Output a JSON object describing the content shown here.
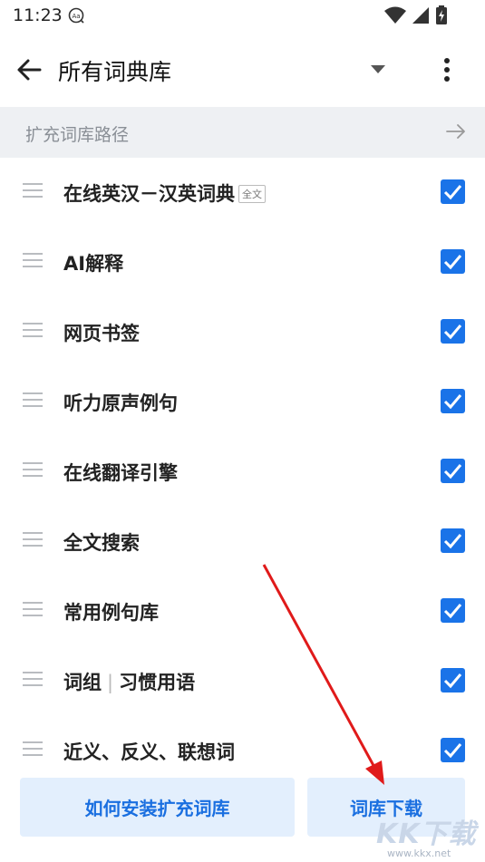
{
  "status": {
    "time": "11:23"
  },
  "header": {
    "title": "所有词典库"
  },
  "path_bar": {
    "label": "扩充词库路径"
  },
  "dictionaries": [
    {
      "label": "在线英汉－汉英词典",
      "tag": "全文",
      "checked": true
    },
    {
      "label": "AI解释",
      "checked": true
    },
    {
      "label": "网页书签",
      "checked": true
    },
    {
      "label": "听力原声例句",
      "checked": true
    },
    {
      "label": "在线翻译引擎",
      "checked": true
    },
    {
      "label": "全文搜索",
      "checked": true
    },
    {
      "label": "常用例句库",
      "checked": true
    },
    {
      "label": "词组",
      "label2": "习惯用语",
      "checked": true
    },
    {
      "label": "近义、反义、联想词",
      "checked": true
    }
  ],
  "buttons": {
    "install": "如何安装扩充词库",
    "download": "词库下载"
  },
  "watermark": {
    "logo": "KK下载",
    "url": "www.kkx.net"
  },
  "colors": {
    "accent": "#1a73e8",
    "button_bg": "#e3effd",
    "annotation": "#e01a1a"
  }
}
